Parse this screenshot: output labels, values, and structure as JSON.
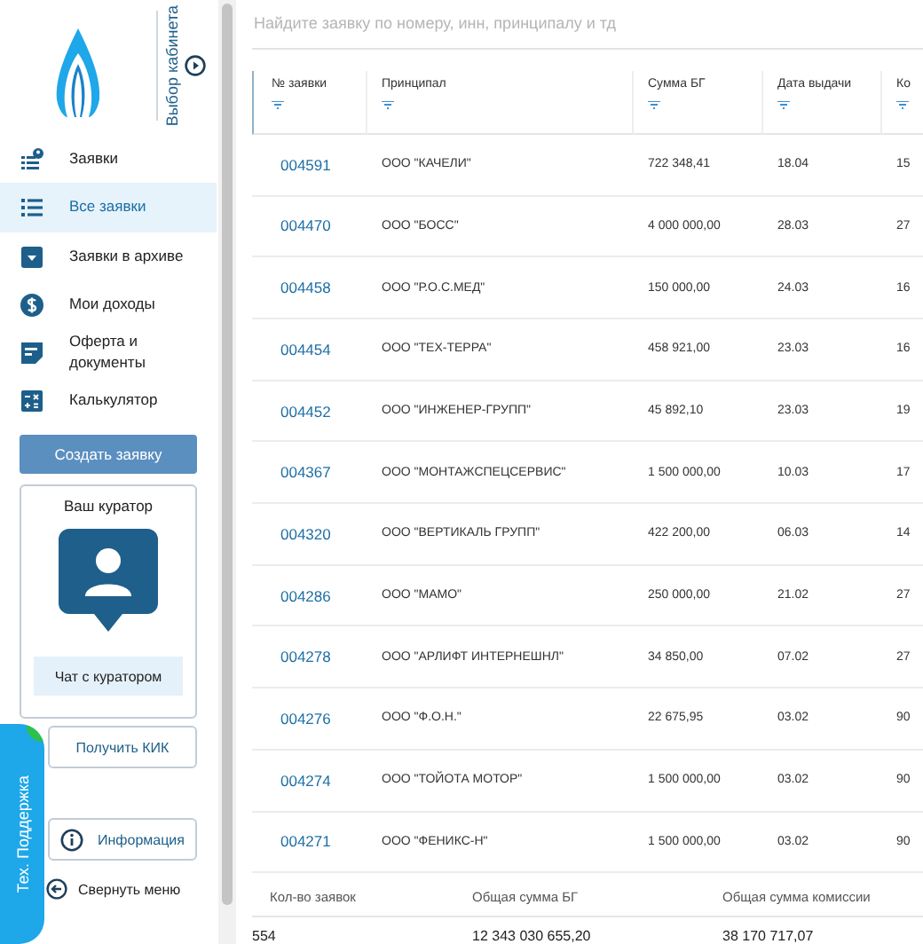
{
  "sidebar": {
    "cabinet_label": "Выбор кабинета",
    "menu": [
      {
        "label": "Заявки",
        "kind": "requests",
        "selected": false
      },
      {
        "label": "Все заявки",
        "kind": "list",
        "selected": true
      },
      {
        "label": "Заявки в архиве",
        "kind": "archive",
        "selected": false
      },
      {
        "label": "Мои доходы",
        "kind": "dollar",
        "selected": false
      },
      {
        "label": "Оферта и документы",
        "kind": "document",
        "selected": false
      },
      {
        "label": "Калькулятор",
        "kind": "calculator",
        "selected": false
      }
    ],
    "create_button": "Создать заявку",
    "curator": {
      "title": "Ваш куратор",
      "chat_button": "Чат с куратором"
    },
    "kik_button": "Получить КИК",
    "info_button": "Информация",
    "collapse": "Свернуть меню",
    "support_tab": "Тех. Поддержка"
  },
  "search": {
    "placeholder": "Найдите заявку по номеру, инн, принципалу и тд"
  },
  "table": {
    "columns": [
      "№ заявки",
      "Принципал",
      "Сумма БГ",
      "Дата выдачи",
      "Ко"
    ],
    "rows": [
      [
        "004591",
        "ООО \"КАЧЕЛИ\"",
        "722 348,41",
        "18.04",
        "15"
      ],
      [
        "004470",
        "ООО \"БОСС\"",
        "4 000 000,00",
        "28.03",
        "27"
      ],
      [
        "004458",
        "ООО \"Р.О.С.МЕД\"",
        "150 000,00",
        "24.03",
        "16"
      ],
      [
        "004454",
        "ООО \"ТЕХ-ТЕРРА\"",
        "458 921,00",
        "23.03",
        "16"
      ],
      [
        "004452",
        "ООО \"ИНЖЕНЕР-ГРУПП\"",
        "45 892,10",
        "23.03",
        "19"
      ],
      [
        "004367",
        "ООО \"МОНТАЖСПЕЦСЕРВИС\"",
        "1 500 000,00",
        "10.03",
        "17"
      ],
      [
        "004320",
        "ООО \"ВЕРТИКАЛЬ ГРУПП\"",
        "422 200,00",
        "06.03",
        "14"
      ],
      [
        "004286",
        "ООО \"МАМО\"",
        "250 000,00",
        "21.02",
        "27"
      ],
      [
        "004278",
        "ООО \"АРЛИФТ ИНТЕРНЕШНЛ\"",
        "34 850,00",
        "07.02",
        "27"
      ],
      [
        "004276",
        "ООО \"Ф.О.Н.\"",
        "22 675,95",
        "03.02",
        "90"
      ],
      [
        "004274",
        "ООО \"ТОЙОТА МОТОР\"",
        "1 500 000,00",
        "03.02",
        "90"
      ],
      [
        "004271",
        "ООО \"ФЕНИКС-Н\"",
        "1 500 000,00",
        "03.02",
        "90"
      ]
    ]
  },
  "summary": {
    "labels": [
      "Кол-во заявок",
      "Общая сумма БГ",
      "Общая сумма комиссии"
    ],
    "values": [
      "554",
      "12 343 030 655,20",
      "38 170 717,07"
    ]
  }
}
